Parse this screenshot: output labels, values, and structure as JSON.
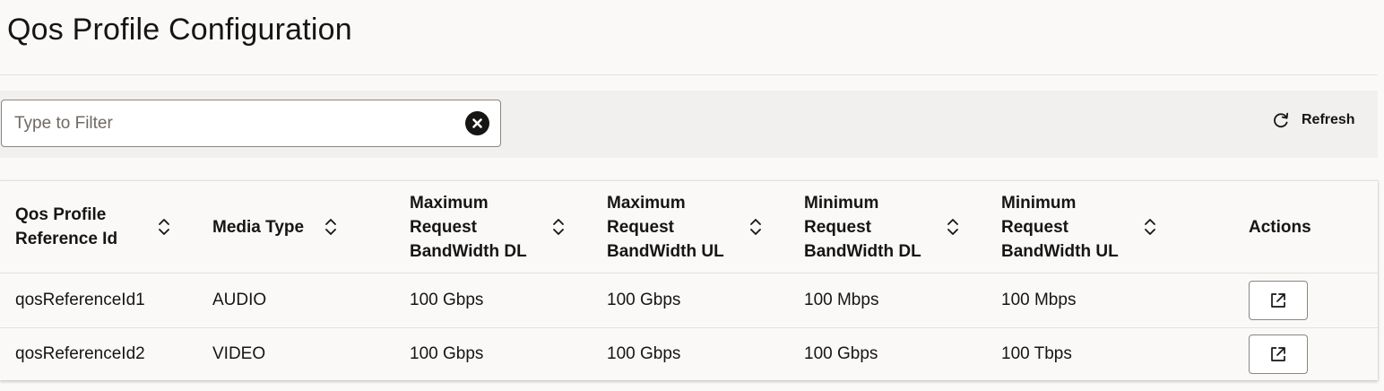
{
  "page": {
    "title": "Qos Profile Configuration"
  },
  "toolbar": {
    "filter_placeholder": "Type to Filter",
    "filter_value": "",
    "refresh_label": "Refresh"
  },
  "table": {
    "columns": [
      {
        "label": "Qos Profile Reference Id",
        "sortable": true
      },
      {
        "label": "Media Type",
        "sortable": true
      },
      {
        "label": "Maximum Request BandWidth DL",
        "sortable": true
      },
      {
        "label": "Maximum Request BandWidth UL",
        "sortable": true
      },
      {
        "label": "Minimum Request BandWidth DL",
        "sortable": true
      },
      {
        "label": "Minimum Request BandWidth UL",
        "sortable": true
      },
      {
        "label": "Actions",
        "sortable": false
      }
    ],
    "rows": [
      {
        "cells": [
          "qosReferenceId1",
          "AUDIO",
          "100 Gbps",
          "100 Gbps",
          "100 Mbps",
          "100 Mbps"
        ]
      },
      {
        "cells": [
          "qosReferenceId2",
          "VIDEO",
          "100 Gbps",
          "100 Gbps",
          "100 Gbps",
          "100 Tbps"
        ]
      }
    ]
  },
  "icons": {
    "clear": "close-circle-icon",
    "refresh": "refresh-icon",
    "sort": "sort-chevrons-icon",
    "action": "open-external-icon"
  },
  "colors": {
    "page_bg": "#fbf9f8",
    "toolbar_bg": "#f1f0ef",
    "text": "#161513",
    "border": "#8b8580",
    "divider": "#e4e1dd"
  }
}
